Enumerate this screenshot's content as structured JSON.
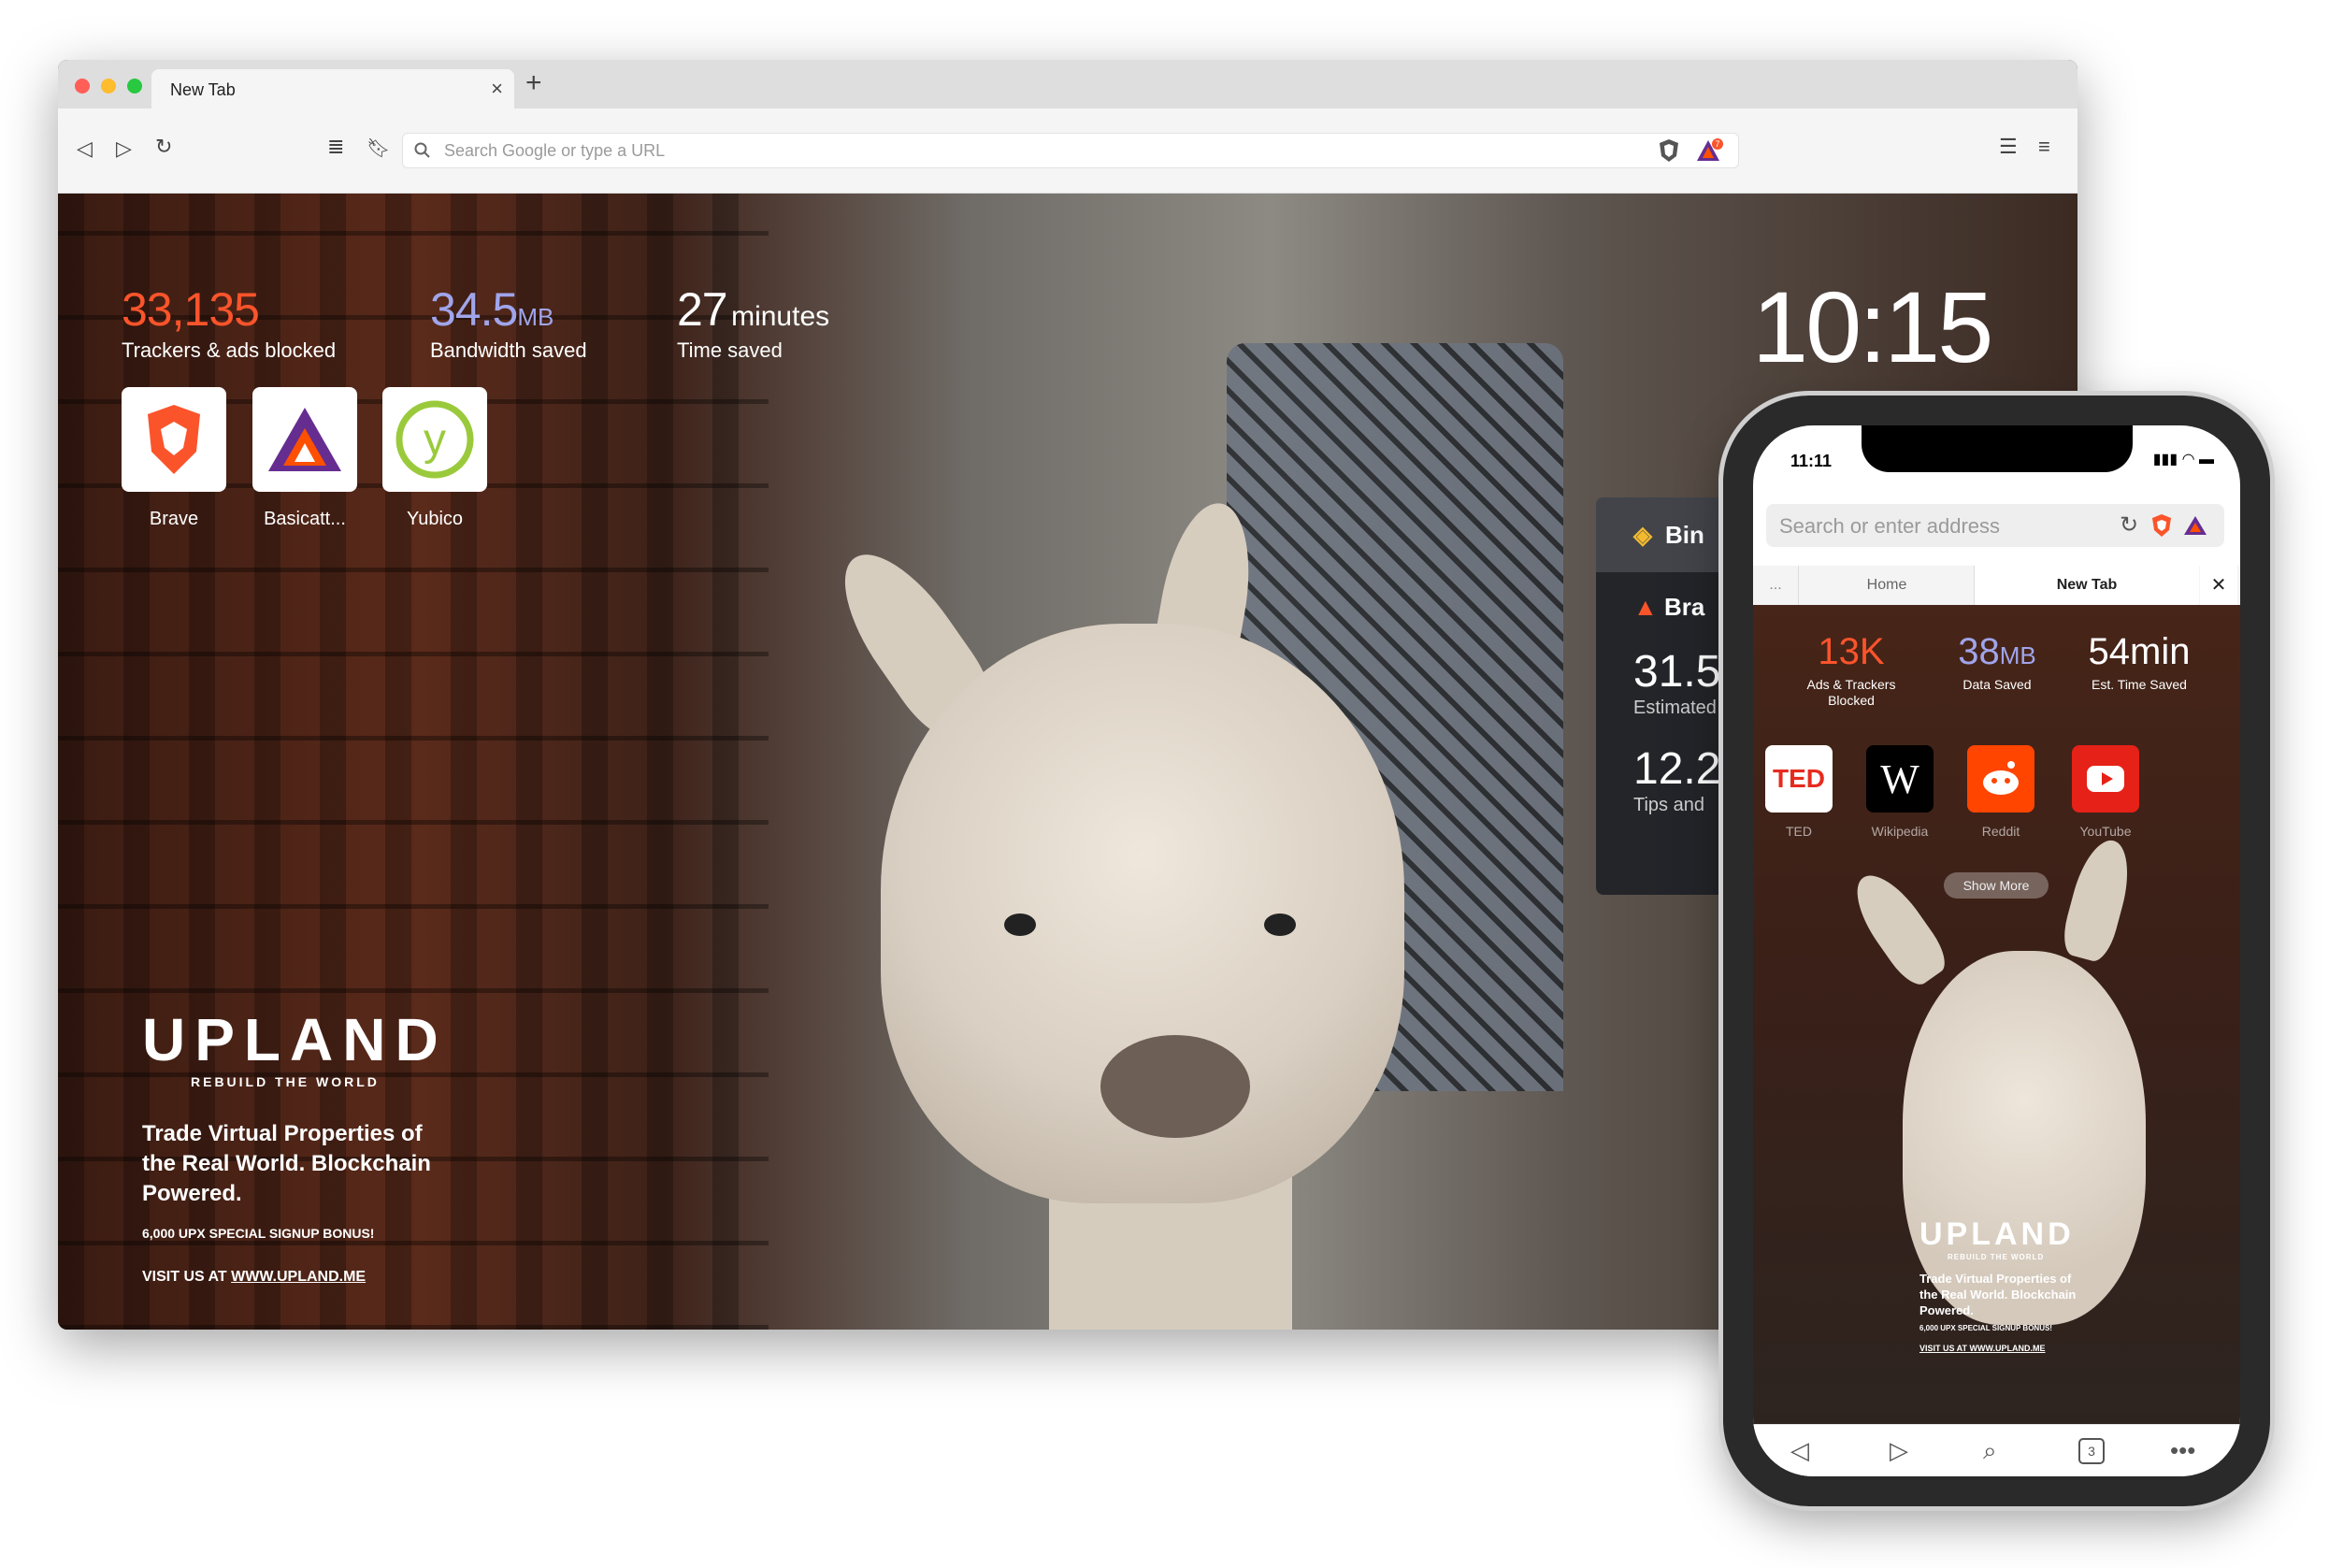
{
  "browser": {
    "tab_title": "New Tab",
    "tab_close": "×",
    "new_tab": "+",
    "search_placeholder": "Search Google or type a URL",
    "rewards_count": "7"
  },
  "new_tab_page": {
    "stats": [
      {
        "value": "33,135",
        "unit": "",
        "label": "Trackers & ads blocked",
        "color": "#fb542b"
      },
      {
        "value": "34.5",
        "unit": "MB",
        "label": "Bandwidth saved",
        "color": "#a0a5eb"
      },
      {
        "value": "27",
        "unit": "minutes",
        "label": "Time saved",
        "color": "#ffffff"
      }
    ],
    "clock": "10:15",
    "top_sites": [
      {
        "label": "Brave",
        "icon": "brave-lion-icon"
      },
      {
        "label": "Basicatt...",
        "icon": "bat-triangle-icon"
      },
      {
        "label": "Yubico",
        "icon": "yubico-icon"
      }
    ],
    "widget": {
      "header": "Bin",
      "title": "Bra",
      "stat1_value": "31.5",
      "stat1_label": "Estimated",
      "stat2_value": "12.2",
      "stat2_label": "Tips and"
    },
    "sponsored": {
      "logo": "UPLAND",
      "tagline": "REBUILD THE WORLD",
      "headline": "Trade Virtual Properties of the Real World. Blockchain Powered.",
      "bonus": "6,000 UPX SPECIAL SIGNUP BONUS!",
      "link_prefix": "VISIT US AT ",
      "link": "WWW.UPLAND.ME"
    }
  },
  "mobile": {
    "status_time": "11:11",
    "search_placeholder": "Search or enter address",
    "tabs": [
      "...",
      "Home",
      "New Tab"
    ],
    "tab_close": "✕",
    "stats": [
      {
        "value": "13K",
        "unit": "",
        "label": "Ads & Trackers Blocked",
        "color": "#fb542b"
      },
      {
        "value": "38",
        "unit": "MB",
        "label": "Data Saved",
        "color": "#a0a5eb"
      },
      {
        "value": "54min",
        "unit": "",
        "label": "Est. Time Saved",
        "color": "#ffffff"
      }
    ],
    "top_sites": [
      {
        "label": "TED",
        "icon": "ted-icon"
      },
      {
        "label": "Wikipedia",
        "icon": "wikipedia-icon"
      },
      {
        "label": "Reddit",
        "icon": "reddit-icon"
      },
      {
        "label": "YouTube",
        "icon": "youtube-icon"
      }
    ],
    "show_more": "Show More",
    "tabs_count": "3",
    "sponsored": {
      "logo": "UPLAND",
      "tagline": "REBUILD THE WORLD",
      "headline": "Trade Virtual Properties of the Real World. Blockchain Powered.",
      "bonus": "6,000 UPX SPECIAL SIGNUP BONUS!",
      "link": "VISIT US AT WWW.UPLAND.ME"
    }
  }
}
